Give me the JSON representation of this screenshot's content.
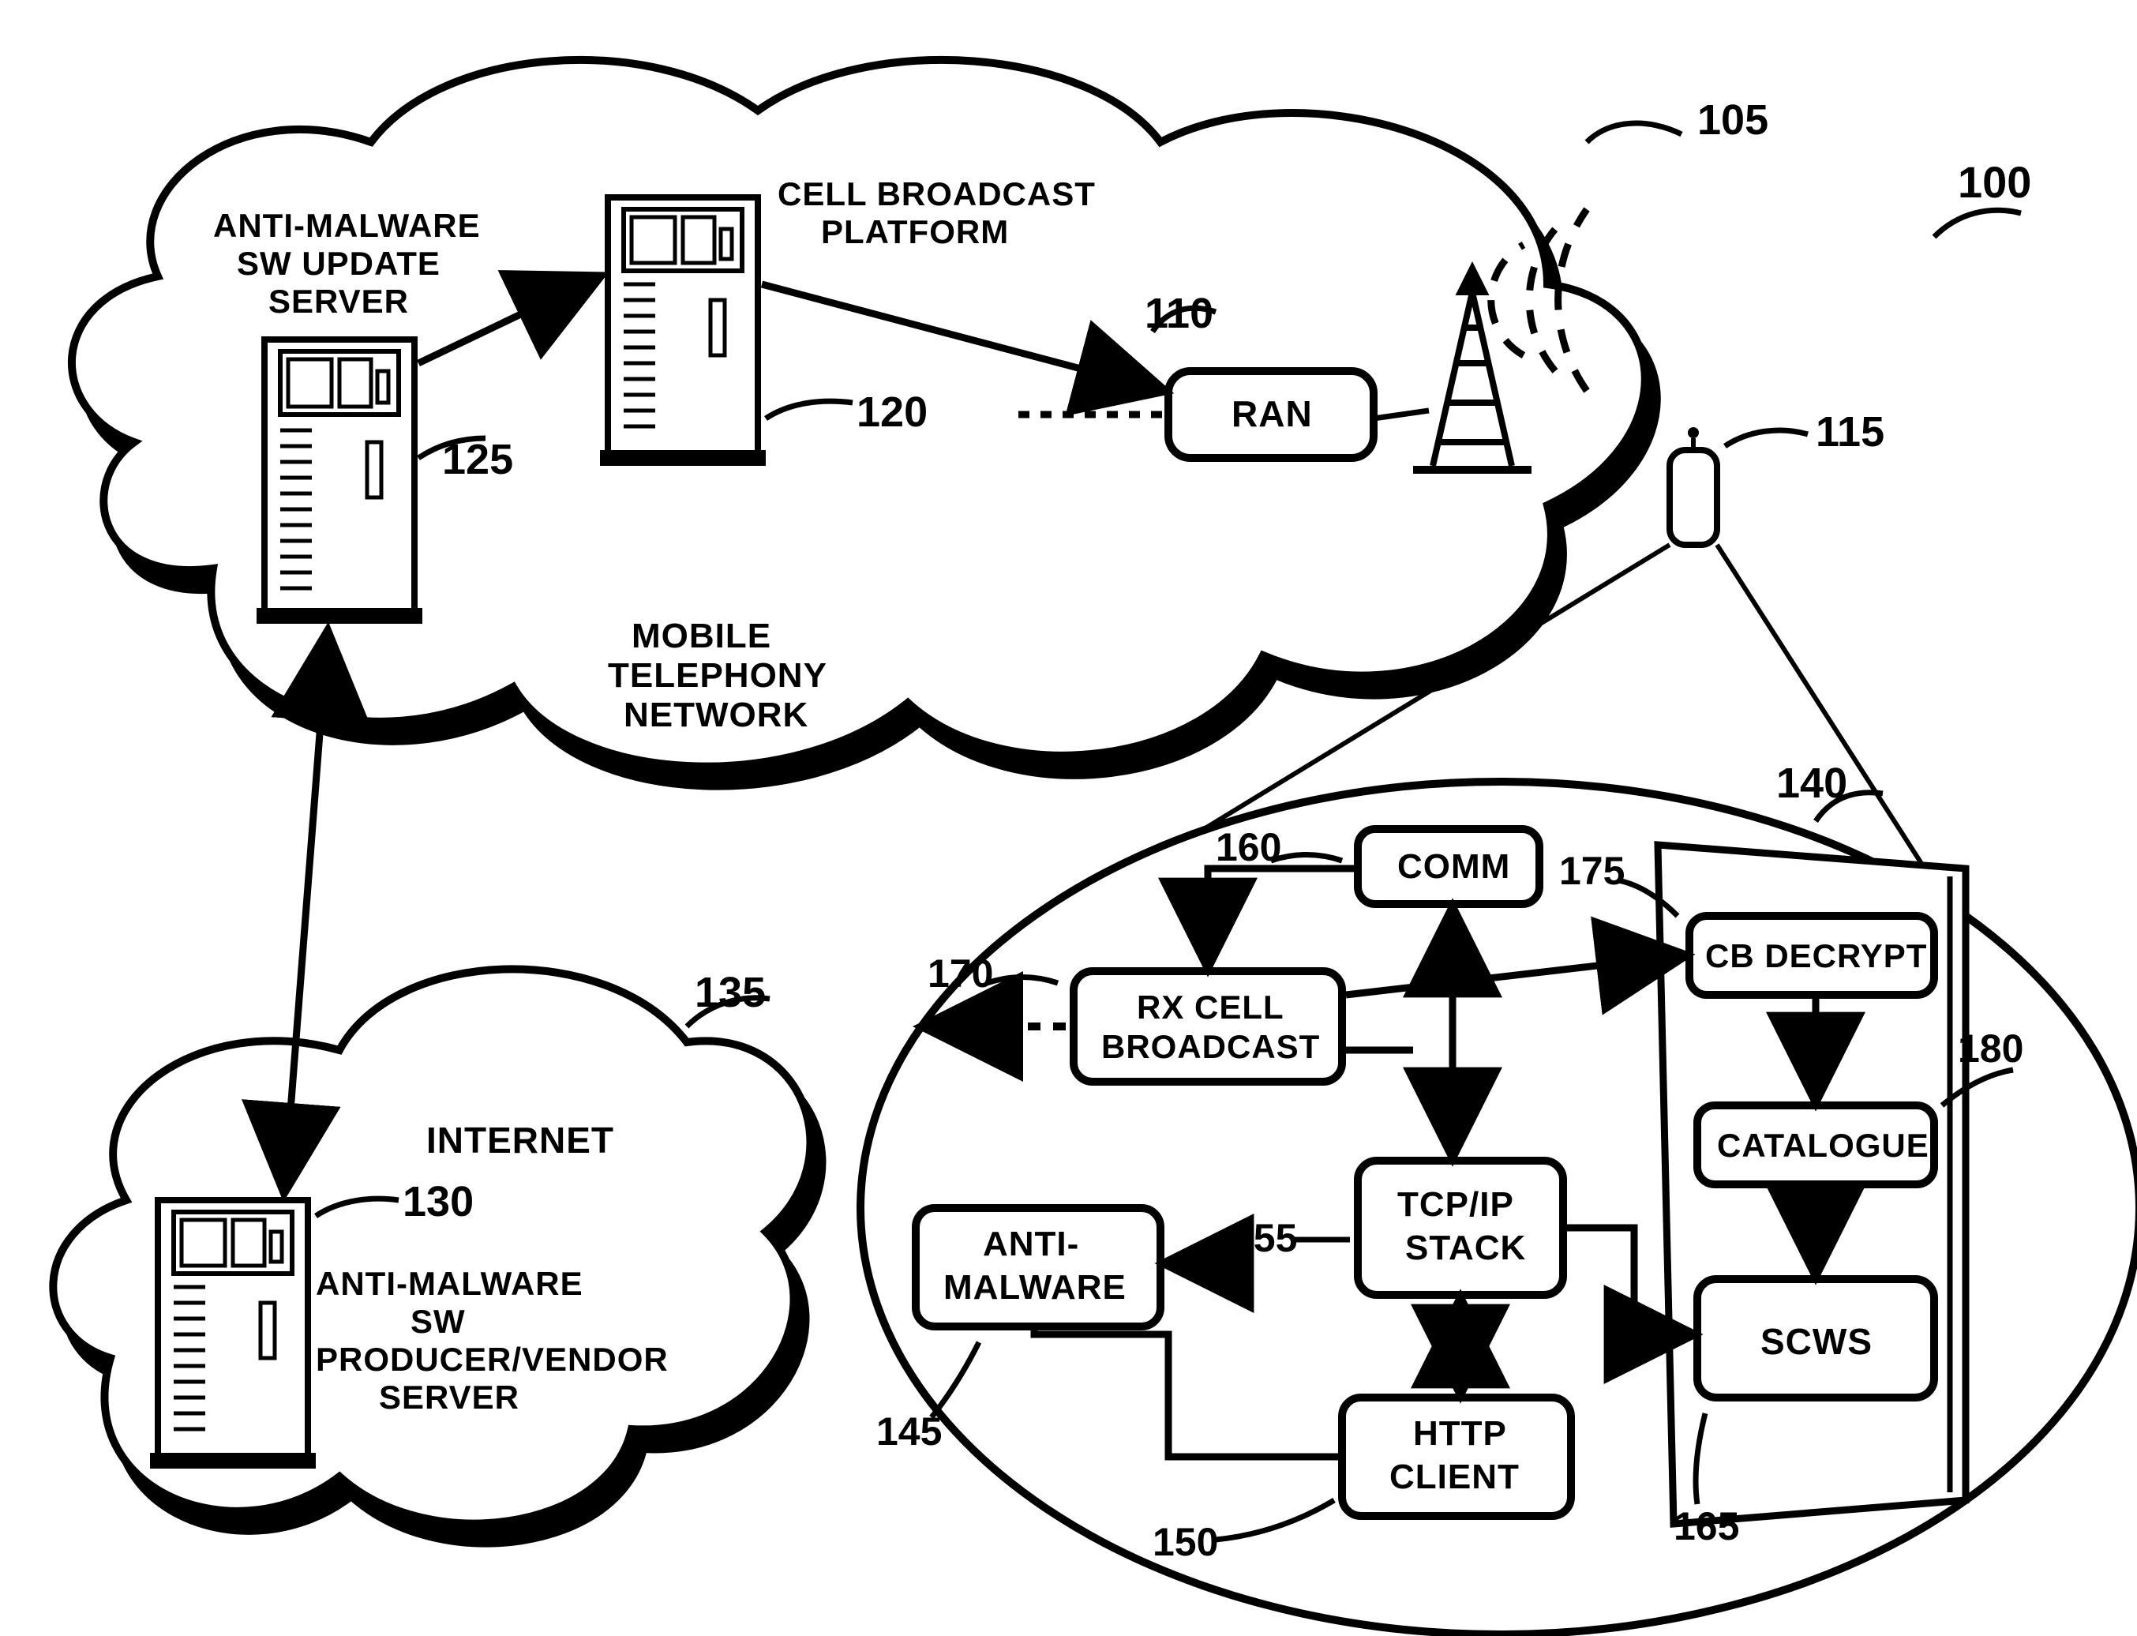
{
  "refs": {
    "system": "100",
    "mobileNetCloud": "105",
    "ran": "110",
    "device": "115",
    "cbPlatform": "120",
    "updateServer": "125",
    "vendorServer": "130",
    "internetCloud": "135",
    "sim": "140",
    "antiMalware": "145",
    "httpClient": "150",
    "tcpIp": "155",
    "comm": "160",
    "scws": "165",
    "rxCell": "170",
    "cbDecrypt": "175",
    "catalogue": "180"
  },
  "labels": {
    "mobileNet1": "MOBILE",
    "mobileNet2": "TELEPHONY",
    "mobileNet3": "NETWORK",
    "internet": "INTERNET",
    "updateServer1": "ANTI-MALWARE",
    "updateServer2": "SW UPDATE",
    "updateServer3": "SERVER",
    "cbPlatform1": "CELL BROADCAST",
    "cbPlatform2": "PLATFORM",
    "ran": "RAN",
    "vendor1": "ANTI-MALWARE",
    "vendor2": "SW",
    "vendor3": "PRODUCER/VENDOR",
    "vendor4": "SERVER",
    "comm": "COMM",
    "rxCell1": "RX CELL",
    "rxCell2": "BROADCAST",
    "tcpIp1": "TCP/IP",
    "tcpIp2": "STACK",
    "antiMalware1": "ANTI-",
    "antiMalware2": "MALWARE",
    "httpClient1": "HTTP",
    "httpClient2": "CLIENT",
    "cbDecrypt": "CB DECRYPT",
    "catalogue": "CATALOGUE",
    "scws": "SCWS"
  }
}
